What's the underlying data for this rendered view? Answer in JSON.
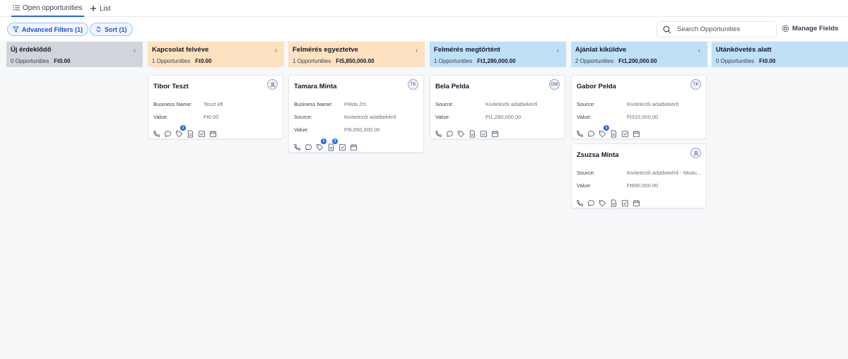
{
  "tabs": {
    "active": "Open opportunities",
    "add_list": "List"
  },
  "toolbar": {
    "filters_label": "Advanced Filters (1)",
    "sort_label": "Sort (1)",
    "search_placeholder": "Search Opportunities",
    "manage_fields_label": "Manage Fields"
  },
  "colors": {
    "accent": "#2563eb",
    "stage_grey": "#d1d5db",
    "stage_orange": "#fde2c1",
    "stage_blue": "#bfe0f5"
  },
  "columns": [
    {
      "title": "Új érdeklődő",
      "count": "0 Opportunities",
      "sum": "Ft0.00",
      "color": "#d1d5db"
    },
    {
      "title": "Kapcsolat felvéve",
      "count": "1 Opportunities",
      "sum": "Ft0.00",
      "color": "#fde2c1"
    },
    {
      "title": "Felmérés egyeztetve",
      "count": "1 Opportunities",
      "sum": "Ft5,850,000.00",
      "color": "#fde2c1"
    },
    {
      "title": "Felmérés megtörtént",
      "count": "1 Opportunities",
      "sum": "Ft1,280,000.00",
      "color": "#bfe0f5"
    },
    {
      "title": "Ajánlat kiküldve",
      "count": "2 Opportunities",
      "sum": "Ft1,200,000.00",
      "color": "#bfe0f5"
    },
    {
      "title": "Utánkövetés alatt",
      "count": "0 Opportunities",
      "sum": "Ft0.00",
      "color": "#bfe0f5"
    }
  ],
  "cards": {
    "tibor": {
      "name": "Tibor Teszt",
      "avatar": "user-icon",
      "f1_label": "Business Name:",
      "f1_value": "Teszt kft",
      "f2_label": "Value:",
      "f2_value": "Ft0.00",
      "badge": "1"
    },
    "tamara": {
      "name": "Tamara Minta",
      "avatar": "TK",
      "f1_label": "Business Name:",
      "f1_value": "Példa Zrt.",
      "f2_label": "Source:",
      "f2_value": "Kivitelezői adatbekérő",
      "f3_label": "Value:",
      "f3_value": "Ft5,850,000.00",
      "badge_tag": "1",
      "badge_doc": "3"
    },
    "bela": {
      "name": "Bela Pelda",
      "avatar": "GM",
      "f1_label": "Source:",
      "f1_value": "Kivitelezői adatbekérő",
      "f2_label": "Value:",
      "f2_value": "Ft1,280,000.00"
    },
    "gabor": {
      "name": "Gabor Pelda",
      "avatar": "TK",
      "f1_label": "Source:",
      "f1_value": "Kivitelezői adatbekérő",
      "f2_label": "Value:",
      "f2_value": "Ft310,000.00",
      "badge": "1"
    },
    "zsuzsa": {
      "name": "Zsuzsa Minta",
      "avatar": "user-icon",
      "f1_label": "Source:",
      "f1_value": "Kivitelezői adatbekérő - Modu...",
      "f2_label": "Value:",
      "f2_value": "Ft890,000.00"
    }
  }
}
